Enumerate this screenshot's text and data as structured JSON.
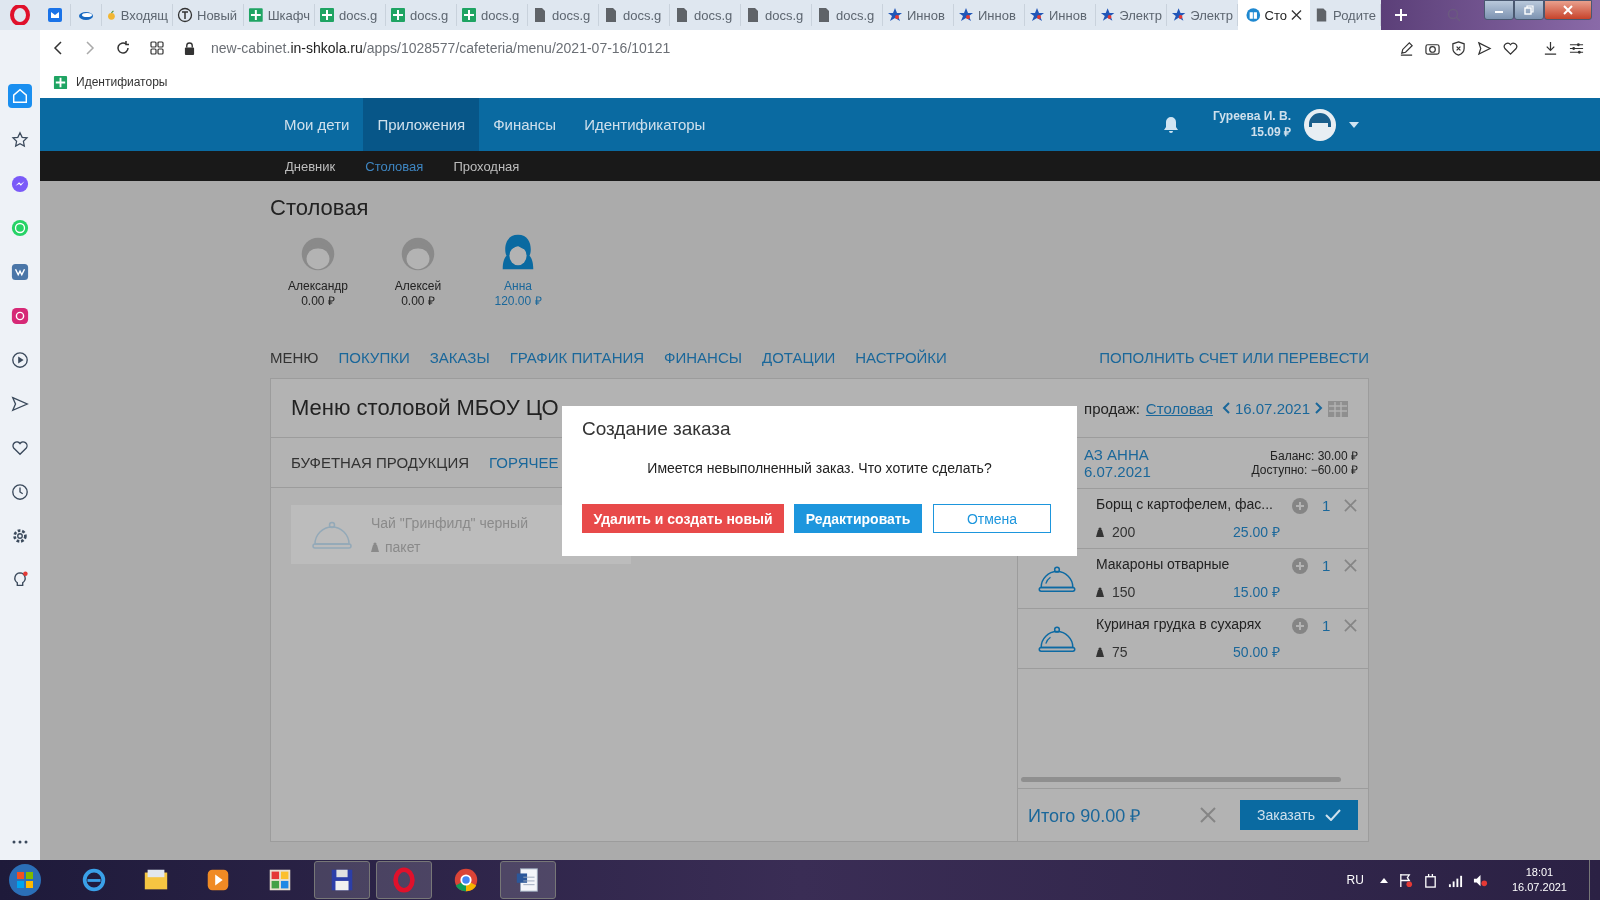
{
  "browser": {
    "tabs": [
      {
        "kind": "mail",
        "selected": false
      },
      {
        "kind": "cloud",
        "selected": false
      },
      {
        "kind": "fruit",
        "label": "Входящ",
        "selected": false
      },
      {
        "kind": "letter",
        "label": "Новый",
        "selected": false
      },
      {
        "kind": "sheet",
        "label": "Шкафч",
        "selected": false
      },
      {
        "kind": "sheet",
        "label": "docs.g",
        "selected": false
      },
      {
        "kind": "sheet",
        "label": "docs.g",
        "selected": false
      },
      {
        "kind": "sheet",
        "label": "docs.g",
        "selected": false
      },
      {
        "kind": "doc",
        "label": "docs.g",
        "selected": false
      },
      {
        "kind": "doc",
        "label": "docs.g",
        "selected": false
      },
      {
        "kind": "doc",
        "label": "docs.g",
        "selected": false
      },
      {
        "kind": "doc",
        "label": "docs.g",
        "selected": false
      },
      {
        "kind": "doc",
        "label": "docs.g",
        "selected": false
      },
      {
        "kind": "star",
        "label": "Иннов",
        "selected": false
      },
      {
        "kind": "star",
        "label": "Иннов",
        "selected": false
      },
      {
        "kind": "star",
        "label": "Иннов",
        "selected": false
      },
      {
        "kind": "star",
        "label": "Электр",
        "selected": false
      },
      {
        "kind": "star",
        "label": "Электр",
        "selected": false
      },
      {
        "kind": "book",
        "label": "Сто",
        "selected": true
      },
      {
        "kind": "doc",
        "label": "Родите",
        "selected": false
      }
    ],
    "address": {
      "prefix": "new-cabinet.",
      "domain": "in-shkola.ru",
      "path": "/apps/1028577/cafeteria/menu/2021-07-16/10121"
    },
    "bookmarks": [
      {
        "kind": "sheet",
        "label": "Идентифиаторы"
      }
    ]
  },
  "sidebar": {
    "items": [
      {
        "kind": "home",
        "selected": true
      },
      {
        "kind": "star",
        "selected": false
      },
      {
        "kind": "messenger",
        "selected": false
      },
      {
        "kind": "whatsapp",
        "selected": false
      },
      {
        "kind": "vk",
        "selected": false
      },
      {
        "kind": "instagram",
        "selected": false
      },
      {
        "kind": "play",
        "selected": false
      },
      {
        "kind": "send",
        "selected": false
      },
      {
        "kind": "heart",
        "selected": false
      },
      {
        "kind": "clock",
        "selected": false
      },
      {
        "kind": "gear",
        "selected": false
      },
      {
        "kind": "bulb",
        "selected": false
      }
    ]
  },
  "header": {
    "nav": [
      {
        "label": "Мои дети",
        "selected": false
      },
      {
        "label": "Приложения",
        "selected": true
      },
      {
        "label": "Финансы",
        "selected": false
      },
      {
        "label": "Идентификаторы",
        "selected": false
      }
    ],
    "user": {
      "name": "Гуреева И. В.",
      "balance": "15.09 ₽"
    }
  },
  "subnav": [
    {
      "label": "Дневник",
      "selected": false
    },
    {
      "label": "Столовая",
      "selected": true
    },
    {
      "label": "Проходная",
      "selected": false
    }
  ],
  "page_title": "Столовая",
  "children": [
    {
      "name": "Александр",
      "balance": "0.00 ₽",
      "kind": "boy",
      "selected": false
    },
    {
      "name": "Алексей",
      "balance": "0.00 ₽",
      "kind": "boy",
      "selected": false
    },
    {
      "name": "Анна",
      "balance": "120.00 ₽",
      "kind": "girl",
      "selected": true
    }
  ],
  "sections": [
    {
      "label": "МЕНЮ",
      "selected": true
    },
    {
      "label": "ПОКУПКИ",
      "selected": false
    },
    {
      "label": "ЗАКАЗЫ",
      "selected": false
    },
    {
      "label": "ГРАФИК ПИТАНИЯ",
      "selected": false
    },
    {
      "label": "ФИНАНСЫ",
      "selected": false
    },
    {
      "label": "ДОТАЦИИ",
      "selected": false
    },
    {
      "label": "НАСТРОЙКИ",
      "selected": false
    }
  ],
  "top_up_link": "ПОПОЛНИТЬ СЧЕТ ИЛИ ПЕРЕВЕСТИ",
  "menu": {
    "title": "Меню столовой МБОУ ЦО",
    "point_label": "продаж:",
    "point_link": "Столовая",
    "date": "16.07.2021",
    "categories": [
      {
        "label": "БУФЕТНАЯ ПРОДУКЦИЯ",
        "selected": true
      },
      {
        "label": "ГОРЯЧЕЕ",
        "selected": false
      }
    ],
    "products": [
      {
        "name": "Чай \"Гринфилд\" черный",
        "unit": "пакет"
      }
    ]
  },
  "order": {
    "title": "АЗ АННА",
    "date": "6.07.2021",
    "balance": "Баланс: 30.00 ₽",
    "available": "Доступно: −60.00 ₽",
    "items": [
      {
        "name": "Борщ с картофелем, фас...",
        "weight": "200",
        "price": "25.00 ₽",
        "qty": "1"
      },
      {
        "name": "Макароны отварные",
        "weight": "150",
        "price": "15.00 ₽",
        "qty": "1"
      },
      {
        "name": "Куриная грудка в сухарях",
        "weight": "75",
        "price": "50.00 ₽",
        "qty": "1"
      }
    ],
    "total": "Итого 90.00 ₽",
    "submit": "Заказать"
  },
  "dialog": {
    "title": "Создание заказа",
    "message": "Имеется невыполненный заказ. Что хотите сделать?",
    "buttons": [
      {
        "label": "Удалить и создать новый",
        "kind": "danger"
      },
      {
        "label": "Редактировать",
        "kind": "primary"
      },
      {
        "label": "Отмена",
        "kind": "outline"
      }
    ]
  },
  "taskbar": {
    "apps": [
      {
        "kind": "ie",
        "open": false
      },
      {
        "kind": "folder",
        "open": false
      },
      {
        "kind": "media",
        "open": false
      },
      {
        "kind": "paint",
        "open": false
      },
      {
        "kind": "floppy",
        "open": true
      },
      {
        "kind": "opera",
        "open": true
      },
      {
        "kind": "chrome",
        "open": false
      },
      {
        "kind": "word",
        "open": true
      }
    ],
    "lang": "RU",
    "time": "18:01",
    "date": "16.07.2021"
  }
}
